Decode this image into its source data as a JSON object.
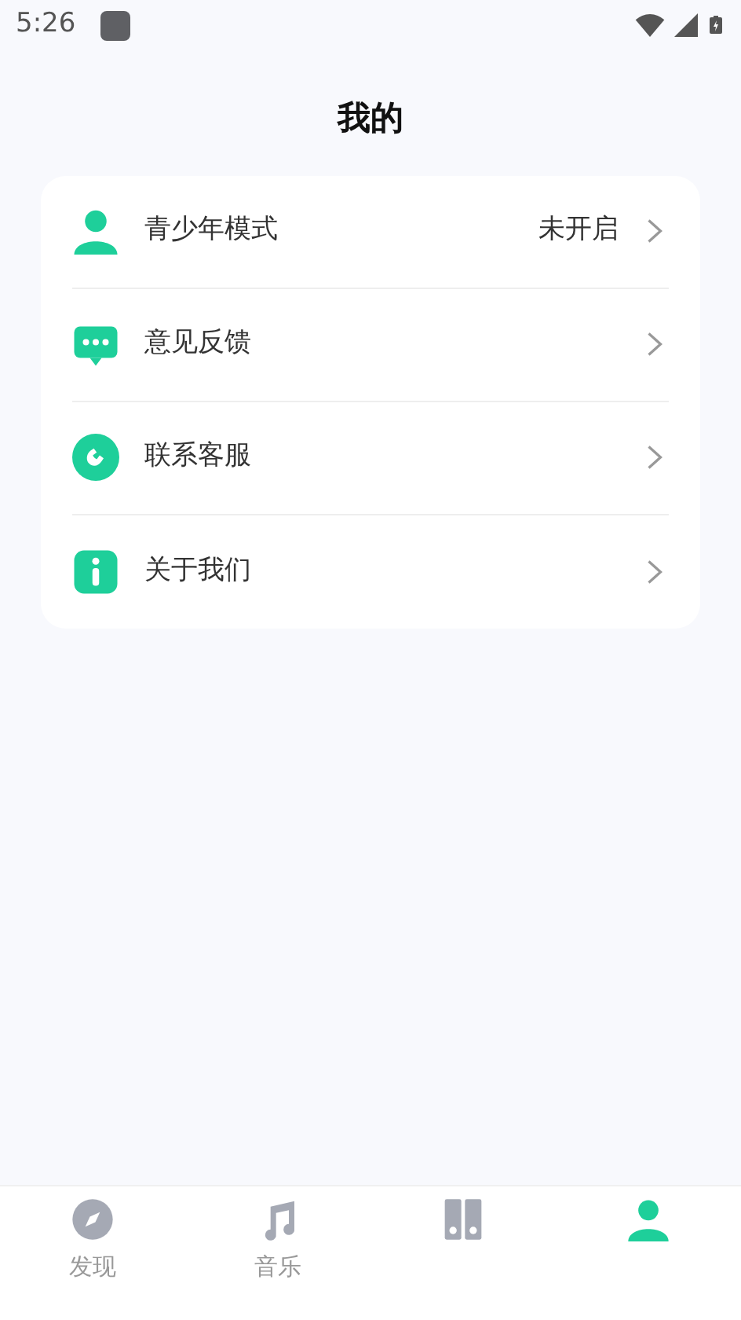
{
  "status_bar": {
    "time": "5:26"
  },
  "header": {
    "title": "我的"
  },
  "menu": [
    {
      "kind": "person",
      "label": "青少年模式",
      "value": "未开启"
    },
    {
      "kind": "chat",
      "label": "意见反馈"
    },
    {
      "kind": "phone",
      "label": "联系客服"
    },
    {
      "kind": "info",
      "label": "关于我们"
    }
  ],
  "bottom_nav": [
    {
      "kind": "compass",
      "label": "发现",
      "selected": false
    },
    {
      "kind": "note",
      "label": "音乐",
      "selected": false
    },
    {
      "kind": "books",
      "selected": false
    },
    {
      "kind": "person",
      "selected": true
    }
  ]
}
